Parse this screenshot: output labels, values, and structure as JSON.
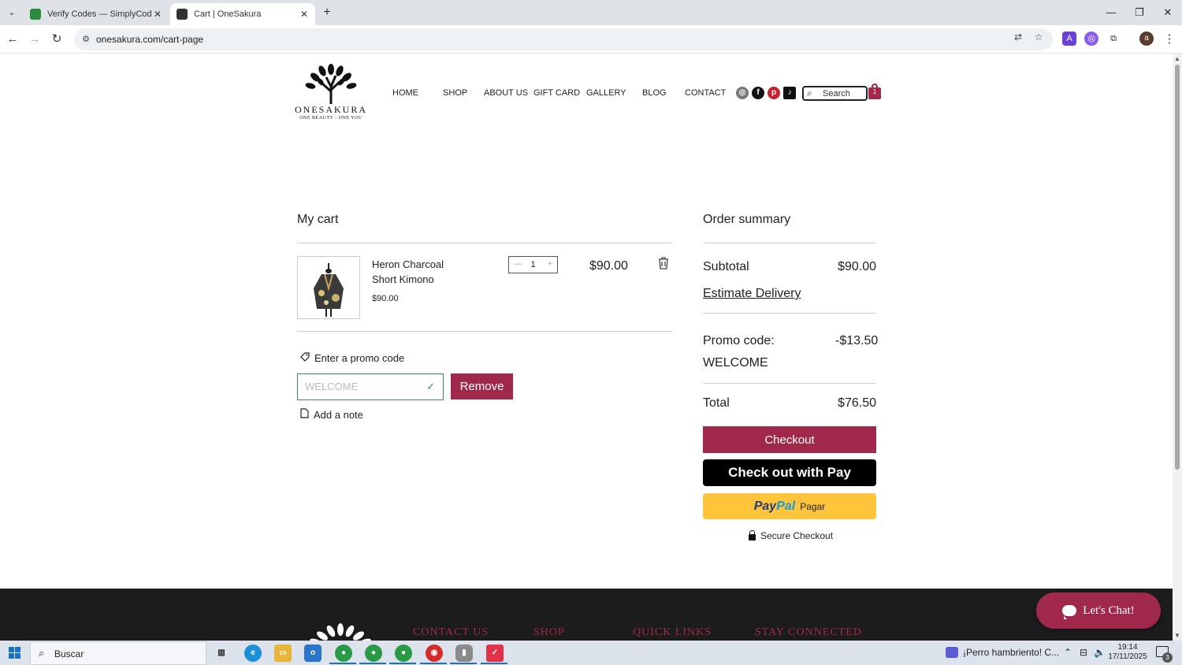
{
  "browser": {
    "tabs": [
      {
        "title": "Verify Codes — SimplyCodes",
        "active": false
      },
      {
        "title": "Cart | OneSakura",
        "active": true
      }
    ],
    "url": "onesakura.com/cart-page"
  },
  "site": {
    "brand": "ONESAKURA",
    "tagline": "ONE BEAUTY - ONE YOU",
    "nav": [
      "HOME",
      "SHOP",
      "ABOUT US",
      "GIFT CARD",
      "GALLERY",
      "BLOG",
      "CONTACT"
    ],
    "search_placeholder": "Search",
    "cart_count": "1",
    "accent_color": "#a0294b"
  },
  "cart": {
    "title": "My cart",
    "items": [
      {
        "name": "Heron Charcoal Short Kimono",
        "unit_price": "$90.00",
        "quantity": "1",
        "line_total": "$90.00"
      }
    ],
    "promo_link": "Enter a promo code",
    "promo_value": "WELCOME",
    "remove_label": "Remove",
    "note_link": "Add a note"
  },
  "summary": {
    "title": "Order summary",
    "subtotal_label": "Subtotal",
    "subtotal_value": "$90.00",
    "estimate_delivery": "Estimate Delivery",
    "promo_label": "Promo code:",
    "promo_code": "WELCOME",
    "promo_discount": "-$13.50",
    "total_label": "Total",
    "total_value": "$76.50",
    "checkout_label": "Checkout",
    "applepay_label": "Check out with  Pay",
    "paypal_brand_1": "Pay",
    "paypal_brand_2": "Pal",
    "paypal_label": "Pagar",
    "secure_label": "Secure Checkout"
  },
  "footer": {
    "headings": [
      "CONTACT US",
      "SHOP",
      "QUICK LINKS",
      "STAY CONNECTED"
    ]
  },
  "chat": {
    "label": "Let's Chat!"
  },
  "taskbar": {
    "search": "Buscar",
    "news": "¡Perro hambriento! C...",
    "time": "19:14",
    "date": "17/11/2025",
    "notifications": "3"
  }
}
